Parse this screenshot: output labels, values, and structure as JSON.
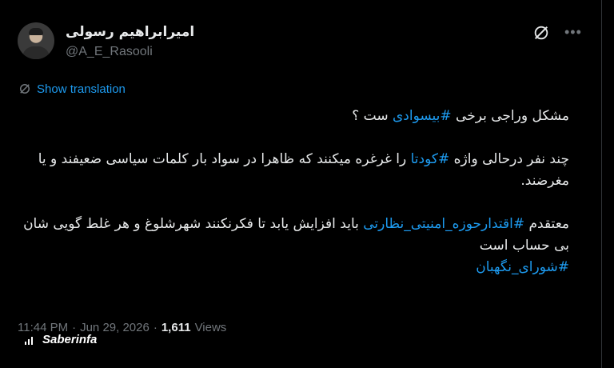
{
  "author": {
    "name": "امیرابراهیم رسولی",
    "handle": "@A_E_Rasooli"
  },
  "translate": {
    "label": "Show translation"
  },
  "tweet": {
    "line1_a": "مشکل وراجی برخی ",
    "line1_tag": "#بیسوادی",
    "line1_b": " ست ؟",
    "para2_a": "چند نفر درحالی واژه ",
    "para2_tag": "#کودتا",
    "para2_b": " را غرغره میکنند که ظاهرا در سواد بار کلمات سیاسی ضعیفند و یا مغرضند.",
    "para3_a": "معتقدم ",
    "para3_tag": "#اقتدارحوزه_امنیتی_نظارتی",
    "para3_b": " باید افزایش یابد تا فکرنکنند شهرشلوغ و هر غلط گویی شان بی حساب است",
    "para3_tag2": "#شورای_نگهبان"
  },
  "meta": {
    "time": "11:44 PM",
    "sep1": "·",
    "date": "Jun 29, 2026",
    "sep2": "·",
    "views_count": "1,611",
    "views_label": "Views"
  },
  "watermark": {
    "text": "Saberinfa"
  },
  "icons": {
    "grok": "grok-icon",
    "more": "more-icon",
    "translate": "translate-icon"
  },
  "colors": {
    "background": "#000000",
    "text": "#e7e9ea",
    "muted": "#71767b",
    "link": "#1d9bf0"
  }
}
